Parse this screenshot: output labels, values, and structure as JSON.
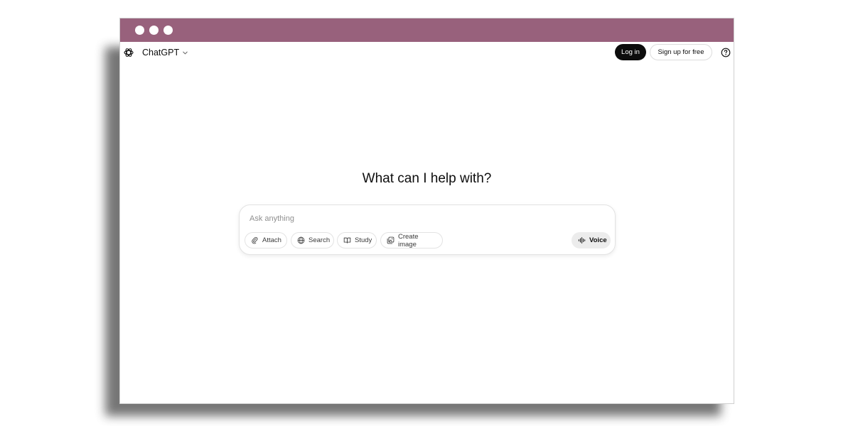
{
  "app": {
    "name": "ChatGPT"
  },
  "header": {
    "login_label": "Log in",
    "signup_label": "Sign up for free"
  },
  "main": {
    "headline": "What can I help with?"
  },
  "composer": {
    "placeholder": "Ask anything",
    "value": "",
    "tools": {
      "attach": "Attach",
      "search": "Search",
      "study": "Study",
      "create_image": "Create image"
    },
    "voice_label": "Voice"
  },
  "colors": {
    "titlebar": "#98617c",
    "login_bg": "#0d0d0d",
    "voice_bg": "#ececec"
  },
  "icons": {
    "logo": "openai-logo-icon",
    "model_menu": "chevron-down-icon",
    "help": "help-icon",
    "attach": "paperclip-icon",
    "search": "globe-icon",
    "study": "book-icon",
    "create_image": "image-icon",
    "voice": "voice-waveform-icon"
  }
}
